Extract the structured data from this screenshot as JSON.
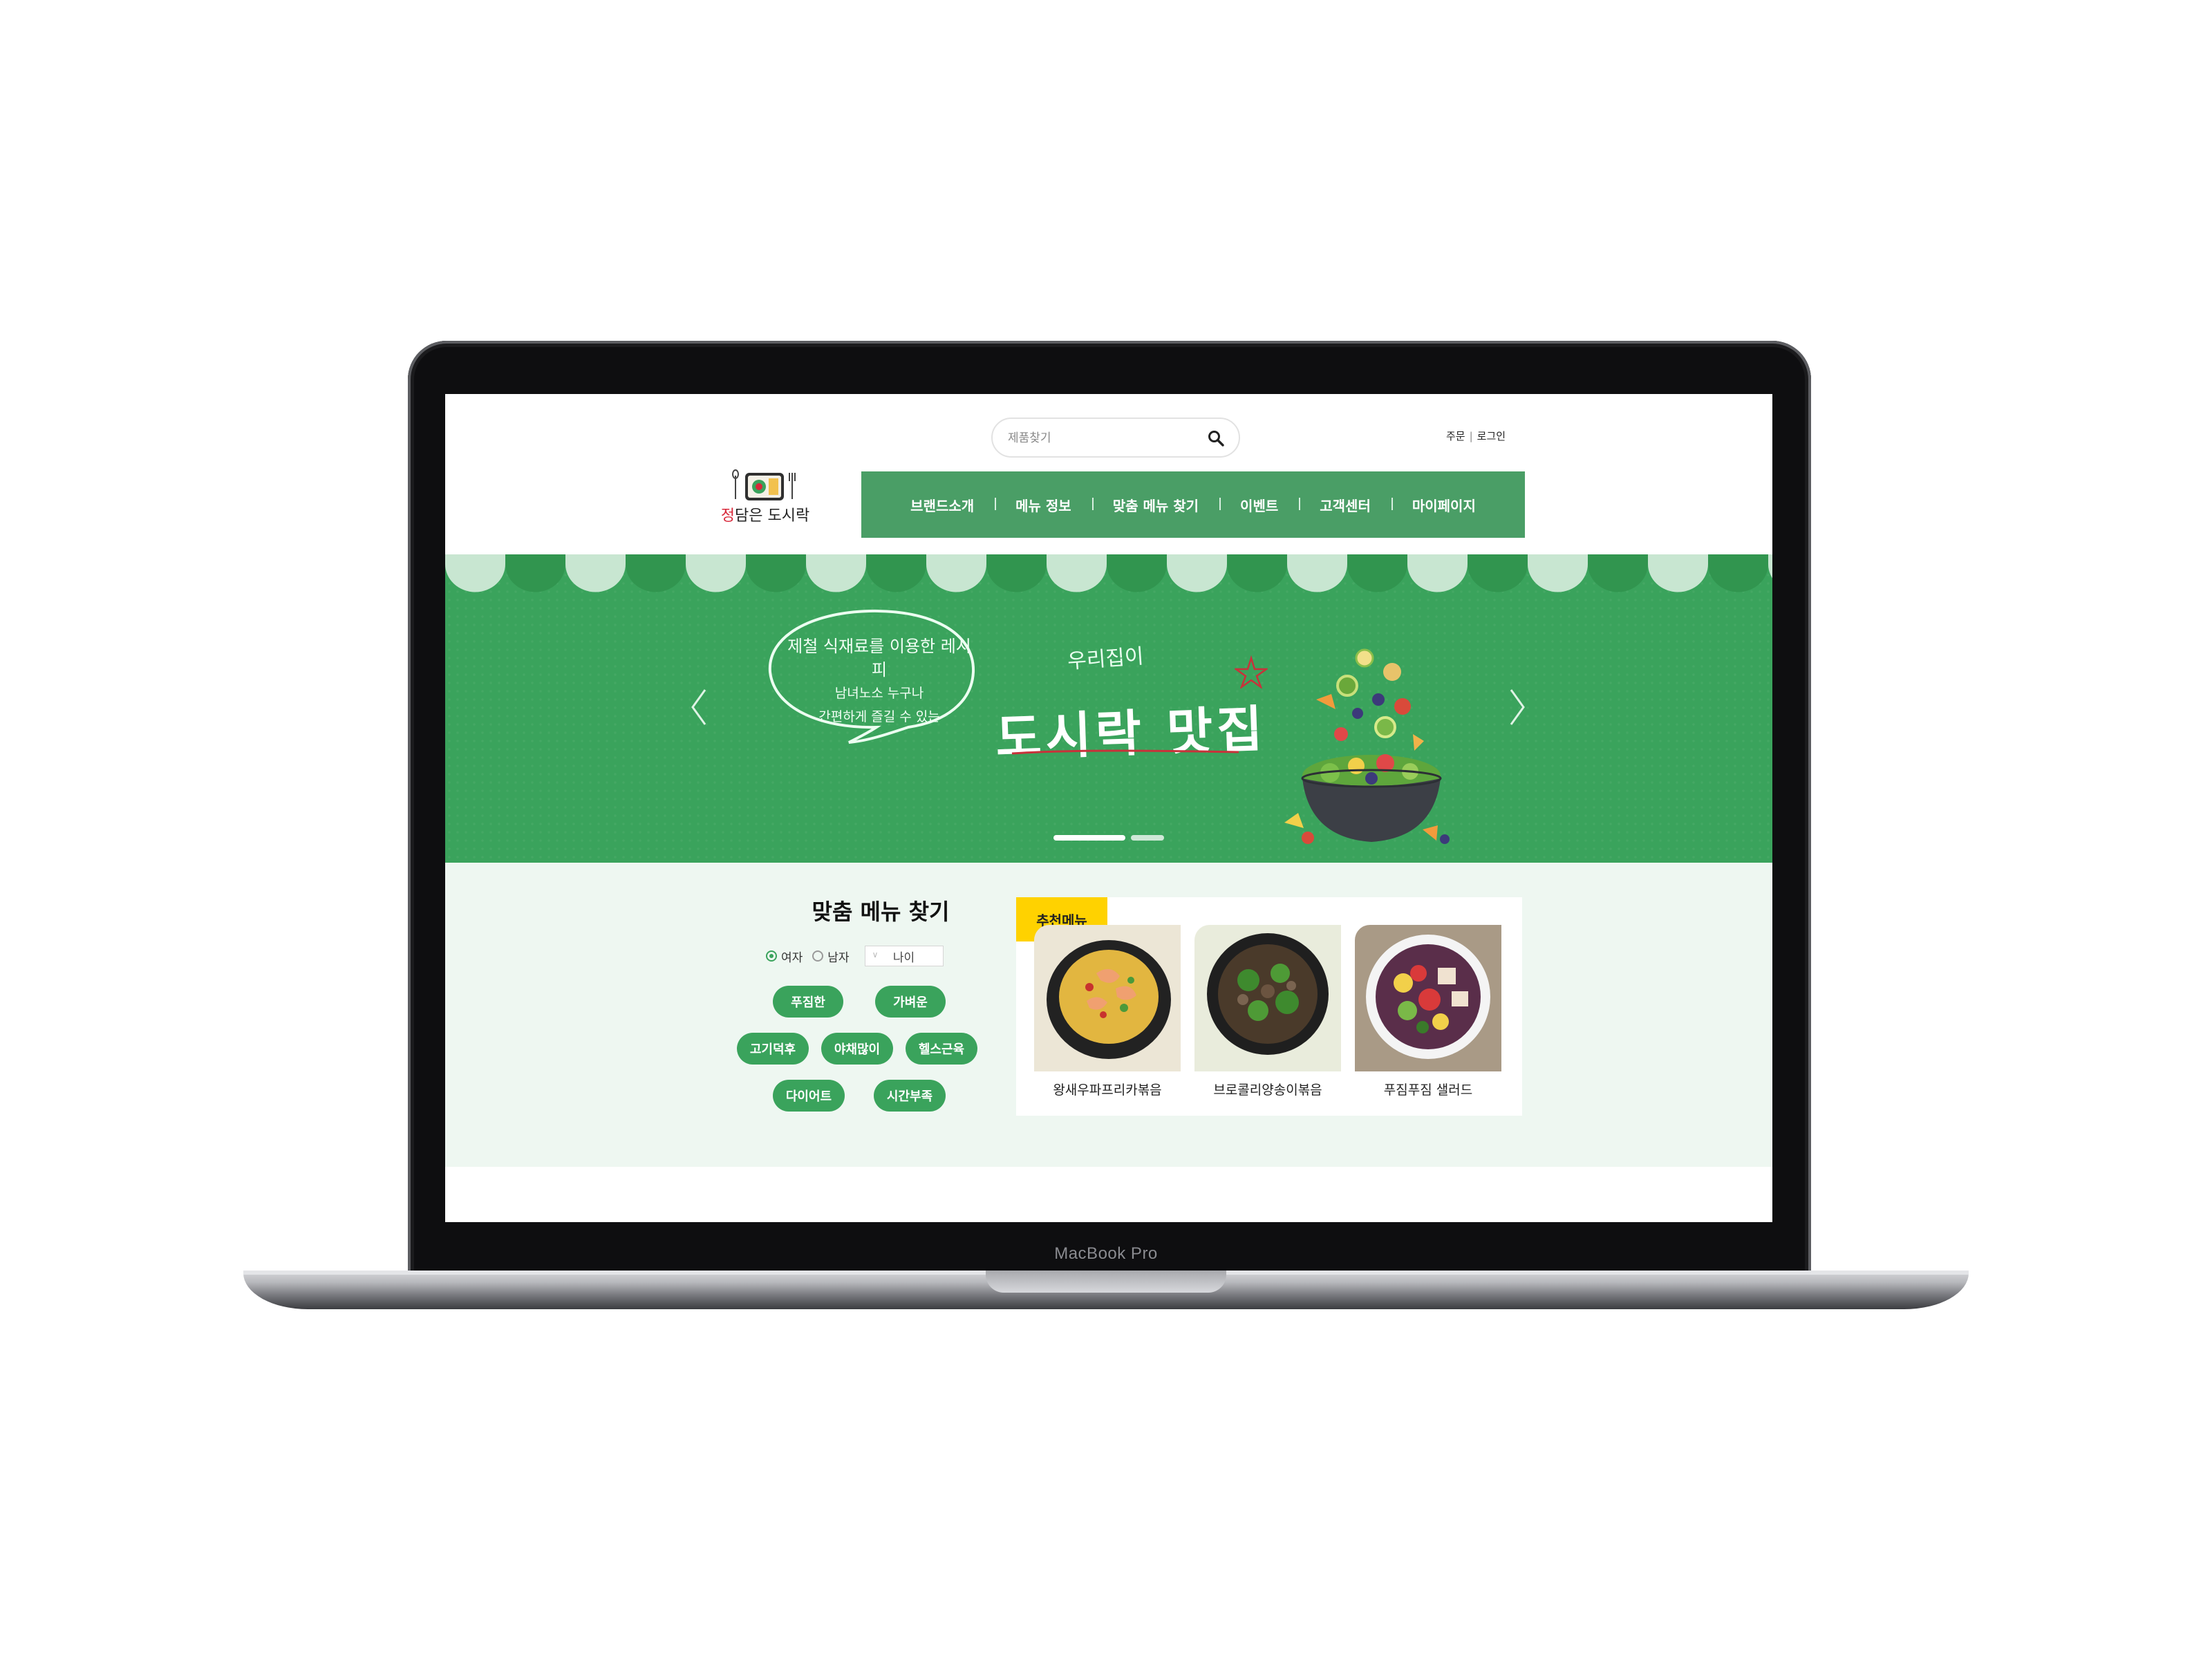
{
  "device": {
    "model_label": "MacBook Pro"
  },
  "header": {
    "search": {
      "placeholder": "제품찾기"
    },
    "util_links": [
      "주문",
      "로그인"
    ],
    "logo": {
      "prefix": "정",
      "rest": "담은 도시락"
    },
    "nav": [
      "브랜드소개",
      "메뉴 정보",
      "맞춤 메뉴 찾기",
      "이벤트",
      "고객센터",
      "마이페이지"
    ]
  },
  "hero": {
    "bubble_lines": [
      "제철 식재료를 이용한 레시피",
      "남녀노소 누구나",
      "간편하게 즐길 수 있는"
    ],
    "small_title": "우리집이",
    "title": "도시락 맛집",
    "pager": {
      "total": 2,
      "active": 1
    }
  },
  "finder": {
    "title": "맞춤 메뉴 찾기",
    "gender_options": [
      "여자",
      "남자"
    ],
    "gender_selected": "여자",
    "age_placeholder": "나이",
    "tags": [
      "푸짐한",
      "가벼운",
      "고기덕후",
      "야채많이",
      "헬스근육",
      "다이어트",
      "시간부족"
    ]
  },
  "recommend": {
    "badge": "추천메뉴",
    "items": [
      "왕새우파프리카볶음",
      "브로콜리양송이볶음",
      "푸짐푸짐 샐러드"
    ]
  },
  "colors": {
    "brand_green": "#3aa35c",
    "nav_green": "#4a9e66",
    "badge_yellow": "#ffd200",
    "section_bg": "#eef7f1"
  }
}
